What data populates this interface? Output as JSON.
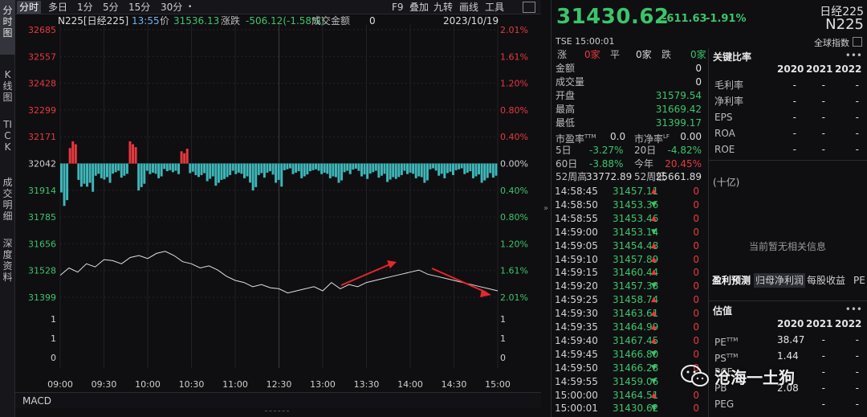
{
  "left_tabs": [
    {
      "label": "分时图",
      "active": true
    },
    {
      "label": "K线图",
      "active": false
    },
    {
      "label": "TICK",
      "active": false
    },
    {
      "label": "成交明细",
      "active": false
    },
    {
      "label": "深度资料",
      "active": false
    }
  ],
  "period_bar": {
    "items": [
      "分时",
      "多日",
      "1分",
      "5分",
      "15分",
      "30分"
    ],
    "dot": "•",
    "tools": [
      "F9",
      "叠加",
      "九转",
      "画线",
      "工具"
    ]
  },
  "info_line": {
    "symbol": "N225[日经225]",
    "time": "13:55",
    "price_label": "价",
    "price": "31536.13",
    "change_label": "涨跌",
    "change": "-506.12(-1.58%)",
    "amount_label": "成交金额",
    "amount": "0",
    "date": "2023/10/19"
  },
  "chart_data": {
    "type": "line",
    "prev_close": 32042,
    "left_ticks": [
      "32685",
      "32557",
      "32428",
      "32299",
      "32171",
      "32042",
      "31914",
      "31785",
      "31656",
      "31528",
      "31399"
    ],
    "right_ticks": [
      "2.01%",
      "1.61%",
      "1.20%",
      "0.80%",
      "0.40%",
      "0.00%",
      "0.40%",
      "0.80%",
      "1.20%",
      "1.61%",
      "2.01%"
    ],
    "volume_ticks": [
      "1",
      "1",
      "0"
    ],
    "x_ticks": [
      "09:00",
      "09:30",
      "10:00",
      "10:30",
      "11:00",
      "12:30",
      "13:00",
      "13:30",
      "14:00",
      "14:30",
      "15:00"
    ],
    "price_series": [
      31505,
      31540,
      31520,
      31560,
      31545,
      31580,
      31575,
      31560,
      31590,
      31600,
      31585,
      31610,
      31620,
      31600,
      31570,
      31560,
      31540,
      31550,
      31530,
      31500,
      31480,
      31470,
      31450,
      31460,
      31445,
      31440,
      31420,
      31430,
      31440,
      31450,
      31430,
      31470,
      31440,
      31460,
      31450,
      31470,
      31480,
      31490,
      31500,
      31510,
      31520,
      31530,
      31510,
      31500,
      31490,
      31480,
      31470,
      31460,
      31450,
      31440,
      31430
    ],
    "bar_series": [
      -0.6,
      0.3,
      -0.3,
      -0.4,
      -0.2,
      -0.25,
      -0.15,
      -0.2,
      0.3,
      -0.35,
      -0.15,
      -0.2,
      -0.1,
      -0.15,
      0.2,
      -0.15,
      -0.2,
      -0.25,
      -0.3,
      -0.2,
      -0.15,
      -0.2,
      -0.35,
      -0.2,
      -0.15,
      -0.3,
      -0.1,
      -0.15,
      -0.2,
      -0.1,
      -0.15,
      -0.2,
      -0.25,
      -0.15,
      -0.1,
      -0.2,
      -0.15,
      -0.2,
      -0.25,
      -0.2,
      -0.15,
      -0.2,
      -0.25,
      -0.1,
      -0.2,
      -0.15,
      -0.1,
      -0.15,
      -0.2,
      -0.25,
      -0.2
    ],
    "arrows": 2
  },
  "macd_label": "MACD",
  "quote": {
    "price": "31430.62",
    "change_pts": "-611.63",
    "change_pct": "-1.91%",
    "exchange_time": "TSE  15:00:01",
    "index_name": "日经225",
    "index_code": "N225",
    "global_index": "全球指数",
    "breadth": {
      "up_label": "涨",
      "up": "0家",
      "flat_label": "平",
      "flat": "0家",
      "down_label": "跌",
      "down": "0家"
    },
    "rows": [
      {
        "label": "金额",
        "value": "0",
        "cls": "white"
      },
      {
        "label": "成交量",
        "value": "0",
        "cls": "white"
      },
      {
        "label": "开盘",
        "value": "31579.54",
        "cls": "down"
      },
      {
        "label": "最高",
        "value": "31669.42",
        "cls": "down"
      },
      {
        "label": "最低",
        "value": "31399.17",
        "cls": "down"
      }
    ],
    "pe": {
      "label": "市盈率",
      "sup": "TTM",
      "value": "0.0",
      "label2": "市净率",
      "sup2": "LF",
      "value2": "0.00"
    },
    "perf1": {
      "l1": "5日",
      "v1": "-3.27%",
      "l2": "20日",
      "v2": "-4.82%"
    },
    "perf2": {
      "l1": "60日",
      "v1": "-3.88%",
      "l2": "今年",
      "v2": "20.45%"
    },
    "week52": {
      "l1": "52周高",
      "v1": "33772.89",
      "l2": "52周低",
      "v2": "25661.89"
    }
  },
  "ticks": [
    {
      "time": "14:58:45",
      "price": "31457.11",
      "dir": "up",
      "vol": "0"
    },
    {
      "time": "14:58:50",
      "price": "31453.36",
      "dir": "down",
      "vol": "0"
    },
    {
      "time": "14:58:55",
      "price": "31453.46",
      "dir": "up",
      "vol": "0"
    },
    {
      "time": "14:59:00",
      "price": "31453.14",
      "dir": "down",
      "vol": "0"
    },
    {
      "time": "14:59:05",
      "price": "31454.48",
      "dir": "up",
      "vol": "0"
    },
    {
      "time": "14:59:10",
      "price": "31457.89",
      "dir": "up",
      "vol": "0"
    },
    {
      "time": "14:59:15",
      "price": "31460.44",
      "dir": "up",
      "vol": "0"
    },
    {
      "time": "14:59:20",
      "price": "31457.38",
      "dir": "down",
      "vol": "0"
    },
    {
      "time": "14:59:25",
      "price": "31458.74",
      "dir": "up",
      "vol": "0"
    },
    {
      "time": "14:59:30",
      "price": "31463.61",
      "dir": "up",
      "vol": "0"
    },
    {
      "time": "14:59:35",
      "price": "31464.99",
      "dir": "up",
      "vol": "0"
    },
    {
      "time": "14:59:40",
      "price": "31467.45",
      "dir": "up",
      "vol": "0"
    },
    {
      "time": "14:59:45",
      "price": "31466.80",
      "dir": "down",
      "vol": "0"
    },
    {
      "time": "14:59:50",
      "price": "31466.28",
      "dir": "down",
      "vol": "0"
    },
    {
      "time": "14:59:55",
      "price": "31459.06",
      "dir": "down",
      "vol": "0"
    },
    {
      "time": "15:00:00",
      "price": "31464.51",
      "dir": "up",
      "vol": "0"
    },
    {
      "time": "15:00:01",
      "price": "31430.62",
      "dir": "down",
      "vol": "0"
    }
  ],
  "ratios": {
    "title": "关键比率",
    "dots": "•••",
    "years": [
      "2020",
      "2021",
      "2022"
    ],
    "rows": [
      {
        "label": "毛利率",
        "v": [
          "-",
          "-",
          "-"
        ]
      },
      {
        "label": "净利率",
        "v": [
          "-",
          "-",
          "-"
        ]
      },
      {
        "label": "EPS",
        "v": [
          "-",
          "-",
          "-"
        ]
      },
      {
        "label": "ROA",
        "v": [
          "-",
          "-",
          "-"
        ]
      },
      {
        "label": "ROE",
        "v": [
          "-",
          "-",
          "-"
        ]
      }
    ]
  },
  "forecast": {
    "tabs": [
      "盈利预测",
      "归母净利润",
      "每股收益",
      "PE"
    ],
    "unit": "(十亿)",
    "empty": "当前暂无相关信息"
  },
  "valuation": {
    "title": "估值",
    "dots": "•••",
    "years": [
      "2020",
      "2021",
      "2022"
    ],
    "rows": [
      {
        "label": "PE",
        "sup": "TTM",
        "v": [
          "38.47",
          "-",
          "-"
        ]
      },
      {
        "label": "PS",
        "sup": "TTM",
        "v": [
          "1.44",
          "-",
          "-"
        ]
      },
      {
        "label": "PCF",
        "sup": "",
        "v": [
          "",
          "-",
          "-"
        ]
      },
      {
        "label": "PB",
        "sup": "",
        "v": [
          "2.08",
          "-",
          "-"
        ]
      },
      {
        "label": "PEG",
        "sup": "",
        "v": [
          "",
          "-",
          "-"
        ]
      }
    ]
  },
  "watermark": "沧海一土狗",
  "colors": {
    "up": "#e8383d",
    "down": "#3cc46a",
    "price_line": "#e0e0e0",
    "bar": "#3fb6b8",
    "arrow": "#e8262b"
  }
}
